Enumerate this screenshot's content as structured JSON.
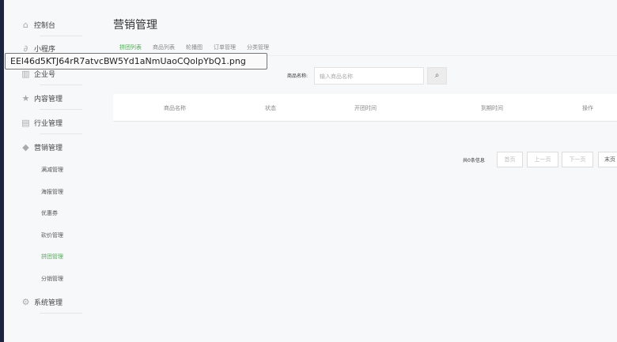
{
  "sidebar": {
    "items": [
      {
        "label": "控制台",
        "icon": "home-icon"
      },
      {
        "label": "小程序",
        "icon": "link-icon"
      },
      {
        "label": "企业号",
        "icon": "building-icon"
      },
      {
        "label": "内容管理",
        "icon": "star-icon"
      },
      {
        "label": "行业管理",
        "icon": "store-icon"
      },
      {
        "label": "营销管理",
        "icon": "tag-icon"
      },
      {
        "label": "系统管理",
        "icon": "gear-icon"
      }
    ],
    "sub_items": [
      "满减管理",
      "海报管理",
      "优惠券",
      "砍价管理",
      "拼团管理",
      "分销管理"
    ]
  },
  "page_title": "营销管理",
  "tabs": [
    "拼团列表",
    "商品列表",
    "轮播图",
    "订单管理",
    "分类管理"
  ],
  "search": {
    "label": "商品名称:",
    "placeholder": "输入商品名称"
  },
  "table": {
    "headers": [
      "商品名称",
      "状态",
      "开团时间",
      "到期时间",
      "操作"
    ]
  },
  "pagination": {
    "total": "共0条信息",
    "first": "首页",
    "prev": "上一页",
    "next": "下一页",
    "last": "末页"
  },
  "tooltip": "EEl46d5KTJ64rR7atvcBW5Yd1aNmUaoCQolpYbQ1.png"
}
